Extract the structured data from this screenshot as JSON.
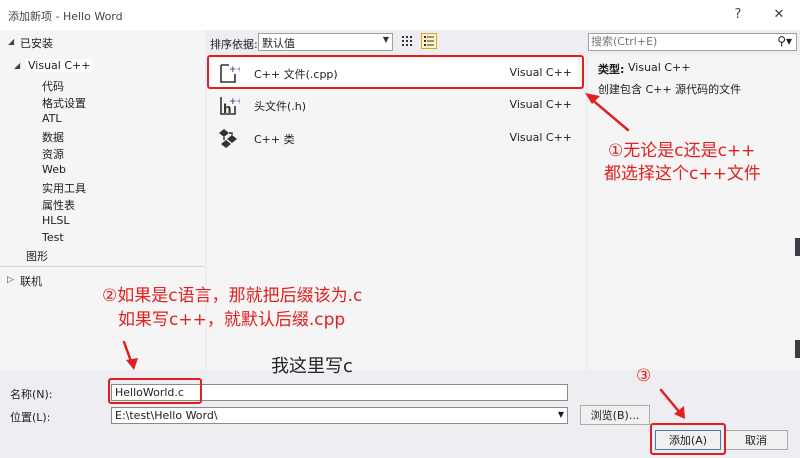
{
  "window": {
    "title": "添加新项 - Hello Word",
    "help": "?",
    "close": "✕"
  },
  "sidebar": {
    "installed": "已安装",
    "category": "Visual C++",
    "items": [
      "代码",
      "格式设置",
      "ATL",
      "数据",
      "资源",
      "Web",
      "实用工具",
      "属性表",
      "HLSL",
      "Test"
    ],
    "graphics": "图形",
    "online": "联机"
  },
  "sortbar": {
    "label": "排序依据:",
    "value": "默认值"
  },
  "search": {
    "placeholder": "搜索(Ctrl+E)"
  },
  "templates": [
    {
      "name": "C++ 文件(.cpp)",
      "lang": "Visual C++"
    },
    {
      "name": "头文件(.h)",
      "lang": "Visual C++"
    },
    {
      "name": "C++ 类",
      "lang": "Visual C++"
    }
  ],
  "details": {
    "type_label": "类型:",
    "type_value": "Visual C++",
    "description": "创建包含 C++ 源代码的文件"
  },
  "form": {
    "name_label": "名称(N):",
    "name_value": "HelloWorld.c",
    "location_label": "位置(L):",
    "location_value": "E:\\test\\Hello Word\\",
    "browse": "浏览(B)...",
    "add": "添加(A)",
    "cancel": "取消"
  },
  "annotations": {
    "a1_line1": "①无论是c还是c++",
    "a1_line2": "都选择这个c++文件",
    "a2_line1": "②如果是c语言，那就把后缀该为.c",
    "a2_line2": "如果写c++，就默认后缀.cpp",
    "a3": "③",
    "note": "我这里写c"
  },
  "colors": {
    "accent_red": "#e02020",
    "selected_bg": "#ffffff",
    "pane_bg": "#f5f5f5",
    "dialog_bg": "#eeeef2"
  }
}
